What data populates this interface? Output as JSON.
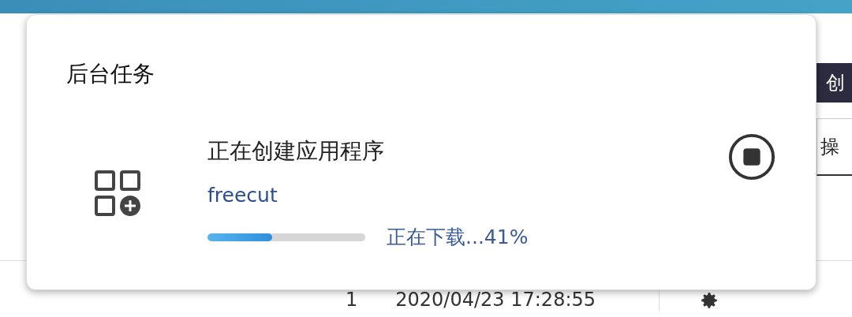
{
  "background": {
    "create_button": "创",
    "column_header": "操",
    "row": {
      "index": "1",
      "time": "2020/04/23 17:28:55"
    }
  },
  "dialog": {
    "title": "后台任务",
    "tasks": [
      {
        "title": "正在创建应用程序",
        "app": "freecut",
        "level": 0.41,
        "status": "正在下载...41%"
      }
    ]
  }
}
